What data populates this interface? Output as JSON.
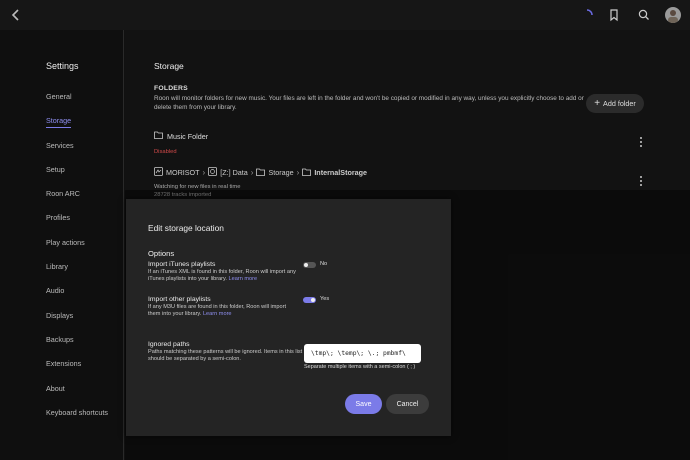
{
  "sidebar": {
    "title": "Settings",
    "items": [
      {
        "label": "General"
      },
      {
        "label": "Storage",
        "active": true
      },
      {
        "label": "Services"
      },
      {
        "label": "Setup"
      },
      {
        "label": "Roon ARC"
      },
      {
        "label": "Profiles"
      },
      {
        "label": "Play actions"
      },
      {
        "label": "Library"
      },
      {
        "label": "Audio"
      },
      {
        "label": "Displays"
      },
      {
        "label": "Backups"
      },
      {
        "label": "Extensions"
      },
      {
        "label": "About"
      },
      {
        "label": "Keyboard shortcuts"
      }
    ]
  },
  "main": {
    "title": "Storage",
    "folders_label": "FOLDERS",
    "folders_desc": "Roon will monitor folders for new music. Your files are left in the folder and won't be copied or modified in any way, unless you explicitly choose to add or delete them from your library.",
    "add_folder_label": "Add folder",
    "music_folder": {
      "name": "Music Folder",
      "status": "Disabled"
    },
    "network_folder": {
      "device": "MORISOT",
      "path": [
        "[Z:] Data",
        "Storage",
        "InternalStorage"
      ],
      "watch_status": "Watching for new files in real time",
      "track_count": "28728 tracks imported"
    }
  },
  "modal": {
    "title": "Edit storage location",
    "options_label": "Options",
    "itunes": {
      "title": "Import iTunes playlists",
      "desc": "If an iTunes XML is found in this folder, Roon will import any iTunes playlists into your library.",
      "learn": "Learn more",
      "state": "No",
      "on": false
    },
    "other": {
      "title": "Import other playlists",
      "desc": "If any M3U files are found in this folder, Roon will import them into your library.",
      "learn": "Learn more",
      "state": "Yes",
      "on": true
    },
    "ignored": {
      "title": "Ignored paths",
      "desc": "Paths matching these patterns will be ignored. Items in this list should be separated by a semi-colon.",
      "value": "\\tmp\\; \\temp\\; \\.; pmbmf\\",
      "help": "Separate multiple items with a semi-colon ( ; )"
    },
    "save_label": "Save",
    "cancel_label": "Cancel"
  },
  "colors": {
    "accent": "#7b7be8",
    "disabled_red": "#d24a4a",
    "background": "#121212",
    "modal_bg": "#242424"
  },
  "icons": {
    "back": "chevron-left-icon",
    "spinner": "loading-spinner-icon",
    "bookmark": "bookmark-icon",
    "search": "search-icon",
    "avatar": "avatar",
    "folder": "folder-icon",
    "device": "device-icon",
    "drive": "drive-icon",
    "kebab": "kebab-menu-icon"
  }
}
